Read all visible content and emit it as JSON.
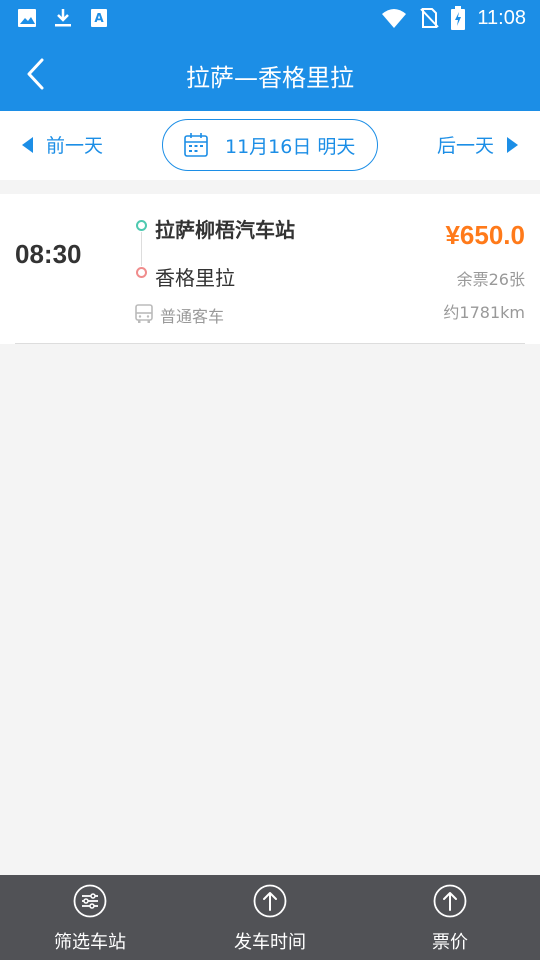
{
  "status_bar": {
    "time": "11:08",
    "icons": [
      "image-icon",
      "download-icon",
      "text-icon",
      "wifi-icon",
      "no-sim-icon",
      "battery-charging-icon"
    ]
  },
  "header": {
    "title": "拉萨—香格里拉",
    "back_icon": "chevron-left-icon"
  },
  "date_bar": {
    "prev_label": "前一天",
    "next_label": "后一天",
    "current_date": "11月16日 明天",
    "calendar_icon": "calendar-icon"
  },
  "trips": [
    {
      "depart_time": "08:30",
      "from_station": "拉萨柳梧汽车站",
      "to_station": "香格里拉",
      "bus_type": "普通客车",
      "price": "¥650.0",
      "seats_left": "余票26张",
      "distance": "约1781km"
    }
  ],
  "bottom_tabs": [
    {
      "label": "筛选车站",
      "icon": "filter-icon"
    },
    {
      "label": "发车时间",
      "icon": "sort-up-icon"
    },
    {
      "label": "票价",
      "icon": "sort-up-icon"
    }
  ],
  "colors": {
    "primary": "#1c8ee6",
    "price": "#ff7a1a",
    "bottom_bar": "#515256"
  }
}
